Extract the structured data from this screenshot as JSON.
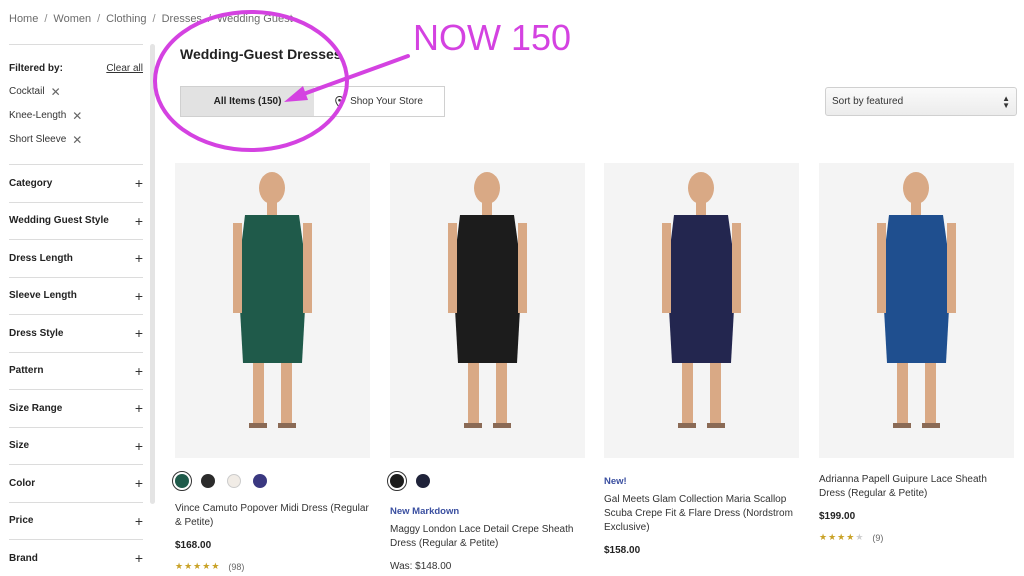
{
  "breadcrumb": [
    "Home",
    "Women",
    "Clothing",
    "Dresses",
    "Wedding Guest"
  ],
  "sidebar": {
    "filtered_by": "Filtered by:",
    "clear_all": "Clear all",
    "active_filters": [
      "Cocktail",
      "Knee-Length",
      "Short Sleeve"
    ],
    "facets": [
      "Category",
      "Wedding Guest Style",
      "Dress Length",
      "Sleeve Length",
      "Dress Style",
      "Pattern",
      "Size Range",
      "Size",
      "Color",
      "Price",
      "Brand"
    ]
  },
  "page_title": "Wedding-Guest Dresses",
  "tabs": {
    "all_items": "All Items (150)",
    "shop_store": "Shop Your Store"
  },
  "sort": {
    "label": "Sort by featured"
  },
  "annotation": {
    "text": "NOW 150",
    "color": "#d442e1"
  },
  "products": [
    {
      "name": "Vince Camuto Popover Midi Dress (Regular & Petite)",
      "badge": "",
      "price": "$168.00",
      "rating": 4.5,
      "reviews": "(98)",
      "dress_color": "#1f5a4a",
      "swatches": [
        "#1f5a4a",
        "#2b2b2b",
        "#f1ece6",
        "#3a3880"
      ]
    },
    {
      "name": "Maggy London Lace Detail Crepe Sheath Dress (Regular & Petite)",
      "badge": "New Markdown",
      "price": "Was: $148.00",
      "rating": null,
      "reviews": "",
      "dress_color": "#1c1c1c",
      "swatches": [
        "#1c1c1c",
        "#20233a"
      ]
    },
    {
      "name": "Gal Meets Glam Collection Maria Scallop Scuba Crepe Fit & Flare Dress (Nordstrom Exclusive)",
      "badge": "New!",
      "price": "$158.00",
      "rating": null,
      "reviews": "",
      "dress_color": "#23264f",
      "swatches": []
    },
    {
      "name": "Adrianna Papell Guipure Lace Sheath Dress (Regular & Petite)",
      "badge": "",
      "price": "$199.00",
      "rating": 4,
      "reviews": "(9)",
      "dress_color": "#1f4f8f",
      "swatches": []
    }
  ]
}
